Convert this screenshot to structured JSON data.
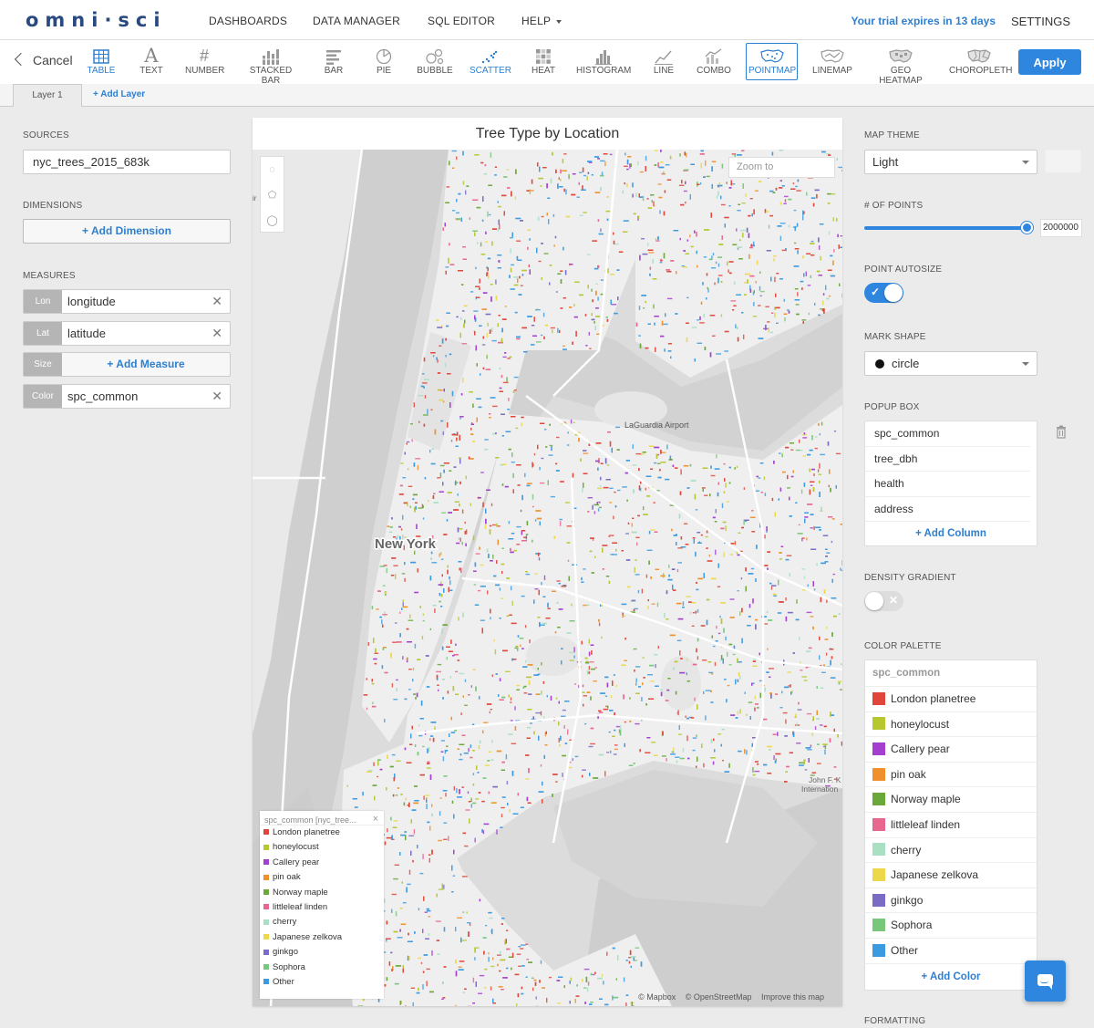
{
  "nav": {
    "logo": "omni·sci",
    "links": [
      "DASHBOARDS",
      "DATA MANAGER",
      "SQL EDITOR",
      "HELP"
    ],
    "trial": "Your trial expires in 13 days",
    "settings": "SETTINGS"
  },
  "toolbar": {
    "cancel": "Cancel",
    "apply": "Apply",
    "chart_types": [
      {
        "label": "TABLE",
        "icon": "table-icon"
      },
      {
        "label": "TEXT",
        "icon": "text-icon"
      },
      {
        "label": "NUMBER",
        "icon": "number-icon"
      },
      {
        "label": "STACKED BAR",
        "icon": "stacked-bar-icon"
      },
      {
        "label": "BAR",
        "icon": "bar-icon"
      },
      {
        "label": "PIE",
        "icon": "pie-icon"
      },
      {
        "label": "BUBBLE",
        "icon": "bubble-icon"
      },
      {
        "label": "SCATTER",
        "icon": "scatter-icon"
      },
      {
        "label": "HEAT",
        "icon": "heat-icon"
      },
      {
        "label": "HISTOGRAM",
        "icon": "histogram-icon"
      },
      {
        "label": "LINE",
        "icon": "line-icon"
      },
      {
        "label": "COMBO",
        "icon": "combo-icon"
      },
      {
        "label": "POINTMAP",
        "icon": "pointmap-icon"
      },
      {
        "label": "LINEMAP",
        "icon": "linemap-icon"
      },
      {
        "label": "GEO HEATMAP",
        "icon": "geo-heatmap-icon"
      },
      {
        "label": "CHOROPLETH",
        "icon": "choropleth-icon"
      }
    ]
  },
  "layers": {
    "tab1": "Layer 1",
    "add": "+ Add Layer"
  },
  "left": {
    "sources_label": "SOURCES",
    "source": "nyc_trees_2015_683k",
    "dimensions_label": "DIMENSIONS",
    "add_dimension": "+ Add Dimension",
    "measures_label": "MEASURES",
    "measures": [
      {
        "tag": "Lon",
        "value": "longitude"
      },
      {
        "tag": "Lat",
        "value": "latitude"
      },
      {
        "tag": "Size",
        "value": "+ Add Measure"
      },
      {
        "tag": "Color",
        "value": "spc_common"
      }
    ]
  },
  "chart": {
    "title": "Tree Type by Location",
    "zoom_placeholder": "Zoom to",
    "labels": {
      "city": "New York",
      "airport": "LaGuardia Airport",
      "jfk": "John F. K",
      "jfk2": "Internation",
      "edge": "ir"
    },
    "attribution": [
      "© Mapbox",
      "© OpenStreetMap",
      "Improve this map"
    ],
    "legend_title": "spc_common [nyc_tree...",
    "legend_close": "×"
  },
  "right": {
    "map_theme_label": "MAP THEME",
    "map_theme": "Light",
    "points_label": "# OF POINTS",
    "points": "2000000",
    "points_fraction": 1.0,
    "autosize_label": "POINT AUTOSIZE",
    "mark_shape_label": "MARK SHAPE",
    "mark_shape": "circle",
    "popup_label": "POPUP BOX",
    "popup_columns": [
      "spc_common",
      "tree_dbh",
      "health",
      "address"
    ],
    "add_column": "+ Add Column",
    "density_label": "DENSITY GRADIENT",
    "palette_label": "COLOR PALETTE",
    "palette_header": "spc_common",
    "add_color": "+ Add Color",
    "formatting_label": "FORMATTING"
  },
  "categories": [
    {
      "name": "London planetree",
      "color": "#e0463a"
    },
    {
      "name": "honeylocust",
      "color": "#b7c72f"
    },
    {
      "name": "Callery pear",
      "color": "#a43ecf"
    },
    {
      "name": "pin oak",
      "color": "#f0902a"
    },
    {
      "name": "Norway maple",
      "color": "#6aa83a"
    },
    {
      "name": "littleleaf linden",
      "color": "#e8678e"
    },
    {
      "name": "cherry",
      "color": "#a9dfc3"
    },
    {
      "name": "Japanese zelkova",
      "color": "#ecd84a"
    },
    {
      "name": "ginkgo",
      "color": "#7a6bc4"
    },
    {
      "name": "Sophora",
      "color": "#78c77a"
    },
    {
      "name": "Other",
      "color": "#3c9be0"
    }
  ]
}
